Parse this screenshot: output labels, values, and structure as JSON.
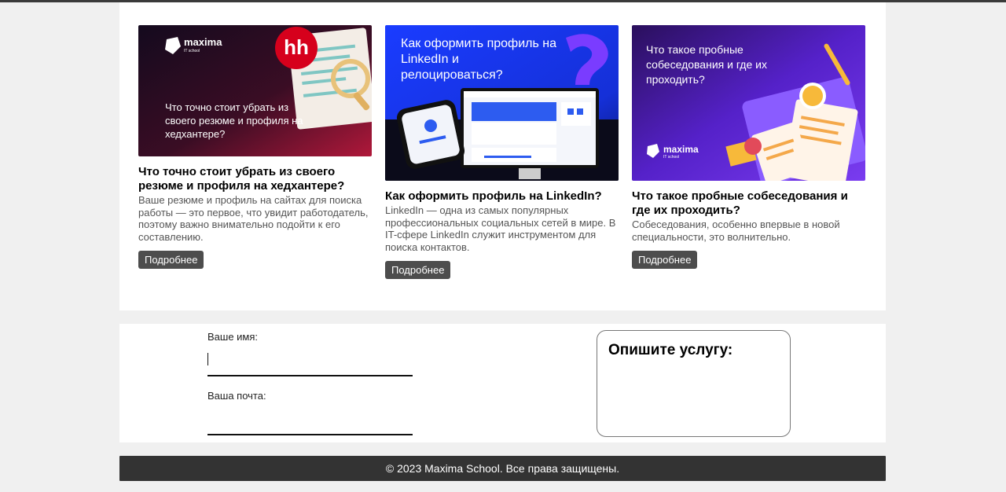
{
  "articles": [
    {
      "banner_text": "Что точно стоит убрать из своего резюме и профиля на хедхантере?",
      "logo_text": "maxima",
      "logo_sub": "IT school",
      "badge_text": "hh",
      "title": "Что точно стоит убрать из своего резюме и профиля на хедхантере?",
      "text": "Ваше резюме и профиль на сайтах для поиска работы — это первое, что увидит работодатель, поэтому важно внимательно подойти к его составлению.",
      "button": "Подробнее"
    },
    {
      "banner_text": "Как оформить профиль на LinkedIn и релоцироваться?",
      "title": "Как оформить профиль на LinkedIn?",
      "text": "LinkedIn — одна из самых популярных профессиональных социальных сетей в мире. В IT-сфере LinkedIn служит инструментом для поиска контактов.",
      "button": "Подробнее"
    },
    {
      "banner_text": "Что такое пробные собеседования и где их проходить?",
      "logo_text": "maxima",
      "logo_sub": "IT school",
      "title": "Что такое пробные собеседования и где их проходить?",
      "text": "Собеседования, особенно впервые в новой специальности, это волнительно.",
      "button": "Подробнее"
    }
  ],
  "form": {
    "name_label": "Ваше имя:",
    "name_value": "",
    "email_label": "Ваша почта:",
    "email_value": "",
    "service_title": "Опишите услугу:"
  },
  "footer": {
    "copyright": "© 2023 Maxima School. Все права защищены."
  },
  "colors": {
    "button_bg": "#4d4d4d",
    "footer_bg": "#333333",
    "linkedin_blue": "#1f3fff",
    "purple": "#6b33e0"
  }
}
